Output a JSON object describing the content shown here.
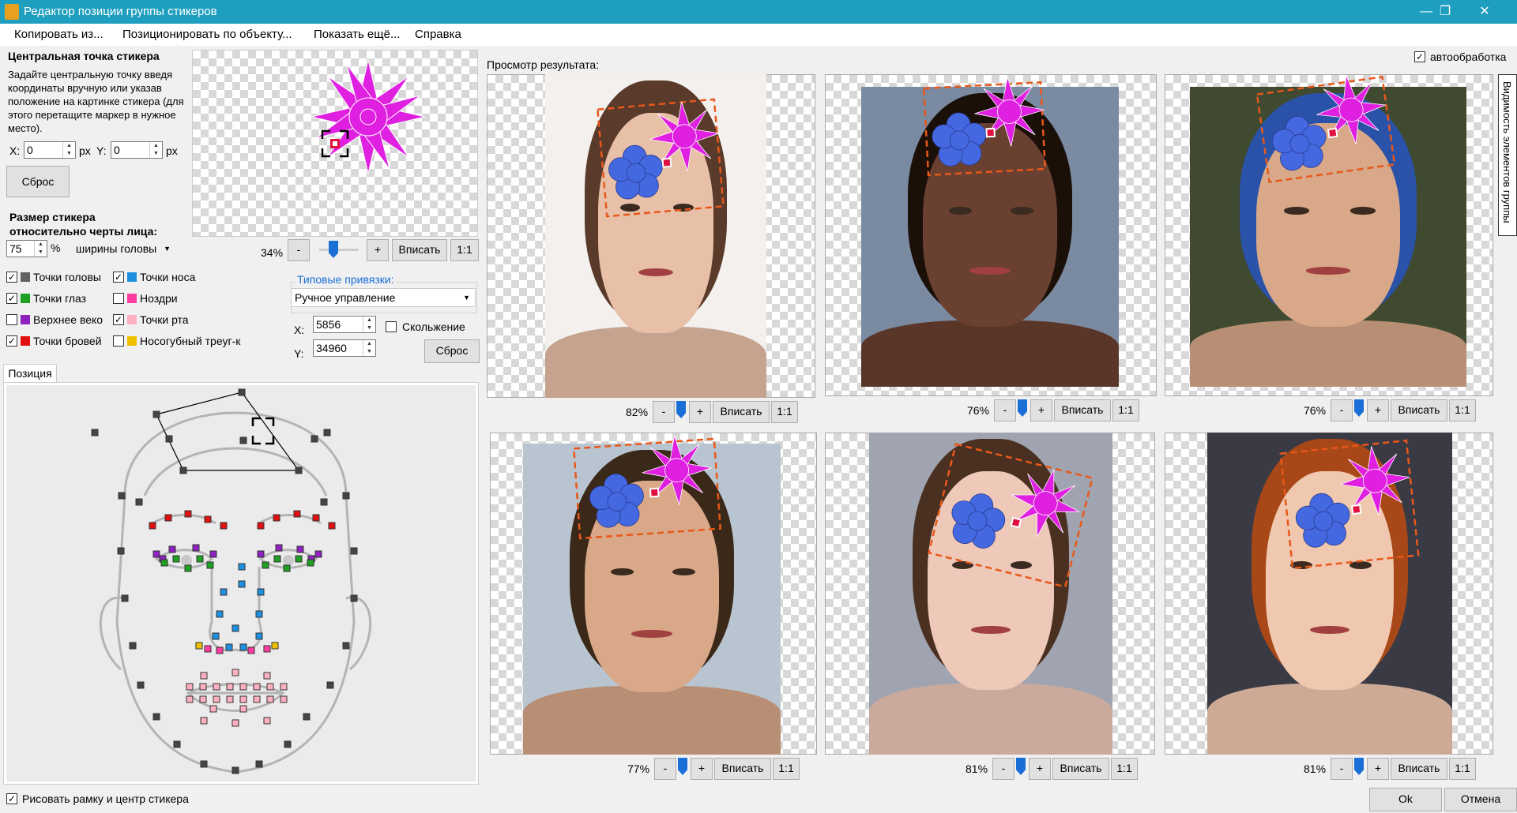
{
  "window": {
    "title": "Редактор позиции группы стикеров",
    "minimize": "—",
    "restore": "❐",
    "close": "✕"
  },
  "menu": [
    "Копировать из...",
    "Позиционировать по объекту...",
    "Показать ещё...",
    "Справка"
  ],
  "center_point": {
    "heading": "Центральная точка стикера",
    "description": "Задайте центральную точку введя координаты вручную или указав положение на картинке стикера (для этого перетащите маркер в нужное место).",
    "x_label": "X:",
    "x_value": "0",
    "x_unit": "px",
    "y_label": "Y:",
    "y_value": "0",
    "y_unit": "px",
    "reset_label": "Сброс"
  },
  "sticker_preview": {
    "zoom": "34%",
    "minus": "-",
    "plus": "+",
    "fit": "Вписать",
    "one": "1:1"
  },
  "size": {
    "heading": "Размер стикера относительно черты лица:",
    "value": "75",
    "unit": "%",
    "relative_to": "ширины головы"
  },
  "points": [
    {
      "label": "Точки головы",
      "checked": true,
      "color": "#606060"
    },
    {
      "label": "Точки носа",
      "checked": true,
      "color": "#1e90e0"
    },
    {
      "label": "Точки глаз",
      "checked": true,
      "color": "#1ea020"
    },
    {
      "label": "Ноздри",
      "checked": false,
      "color": "#ff3ca0"
    },
    {
      "label": "Верхнее веко",
      "checked": false,
      "color": "#9020c0"
    },
    {
      "label": "Точки рта",
      "checked": true,
      "color": "#ffb0c0"
    },
    {
      "label": "Точки бровей",
      "checked": true,
      "color": "#e01010"
    },
    {
      "label": "Носогубный треуг-к",
      "checked": false,
      "color": "#f0c000"
    }
  ],
  "binding": {
    "legend": "Типовые привязки:",
    "mode": "Ручное управление",
    "x_label": "X:",
    "x_value": "5856",
    "y_label": "Y:",
    "y_value": "34960",
    "slide_label": "Скольжение",
    "slide_checked": false,
    "reset_label": "Сброс"
  },
  "position_tab": "Позиция",
  "draw_frame": {
    "label": "Рисовать рамку и центр стикера",
    "checked": true
  },
  "preview": {
    "title": "Просмотр результата:",
    "auto_label": "автообработка",
    "auto_checked": true,
    "visibility_tab": "Видимость элементов группы",
    "cells": [
      {
        "zoom": "82%"
      },
      {
        "zoom": "76%"
      },
      {
        "zoom": "76%"
      },
      {
        "zoom": "77%"
      },
      {
        "zoom": "81%"
      },
      {
        "zoom": "81%"
      }
    ],
    "minus": "-",
    "plus": "+",
    "fit": "Вписать",
    "one": "1:1"
  },
  "buttons": {
    "ok": "Ok",
    "cancel": "Отмена"
  },
  "check_mark": "✓",
  "icons": {
    "titlebar": "app-icon",
    "sticker": "flower-sticker-icon",
    "marker": "center-marker-icon",
    "dropdown": "chevron-down-icon"
  }
}
